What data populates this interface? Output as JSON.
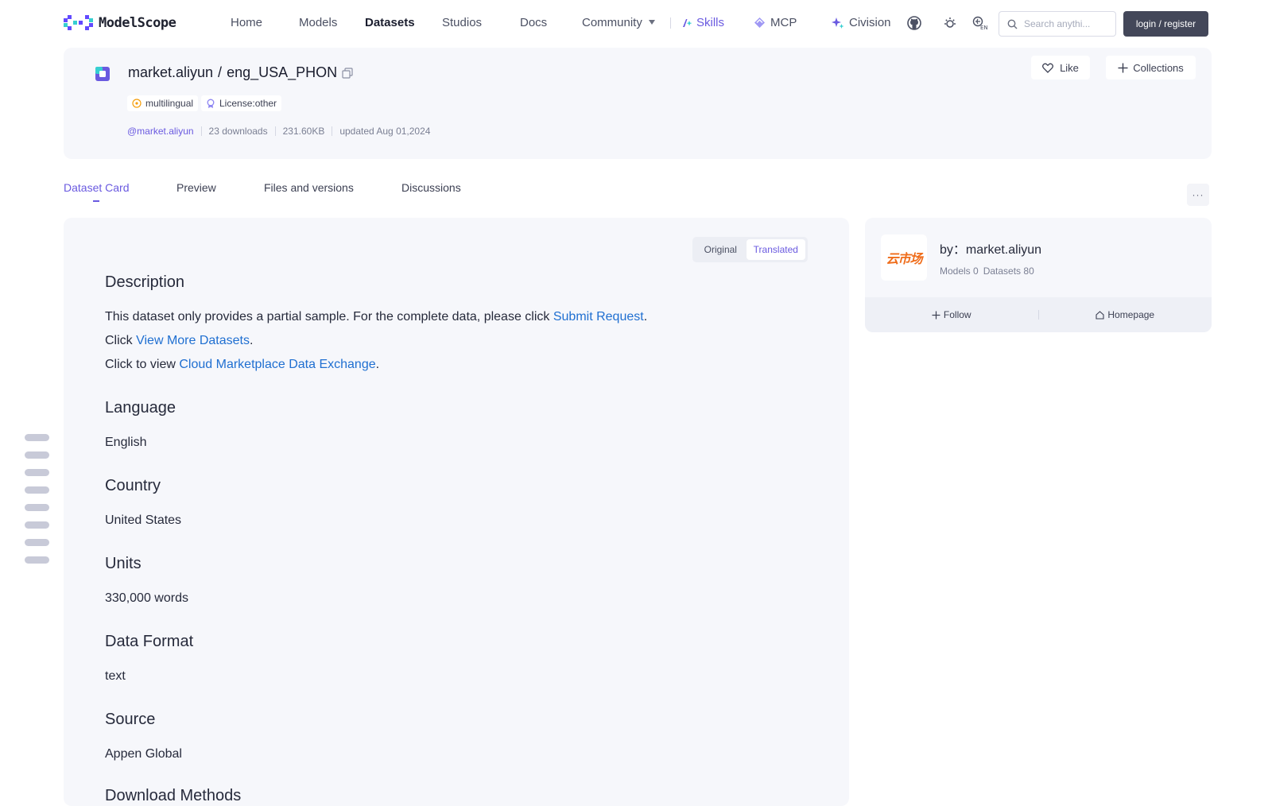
{
  "nav": {
    "logo_text": "ModelScope",
    "items": [
      "Home",
      "Models",
      "Datasets",
      "Studios",
      "Docs"
    ],
    "community": "Community",
    "skills": "Skills",
    "mcp": "MCP",
    "civision": "Civision",
    "search_placeholder": "Search anythi...",
    "login": "login / register"
  },
  "dataset": {
    "owner": "market.aliyun",
    "slash": "/",
    "name": "eng_USA_PHON",
    "tags": [
      "multilingual",
      "License:other"
    ],
    "owner_handle": "@market.aliyun",
    "downloads": "23 downloads",
    "size": "231.60KB",
    "updated": "updated Aug 01,2024",
    "like": "Like",
    "collections": "Collections"
  },
  "tabs": [
    "Dataset Card",
    "Preview",
    "Files and versions",
    "Discussions"
  ],
  "more": "···",
  "toggle": {
    "original": "Original",
    "translated": "Translated"
  },
  "card": {
    "description_h": "Description",
    "line1_pre": "This dataset only provides a partial sample. For the complete data, please click ",
    "line1_link": "Submit Request",
    "line1_post": ".",
    "line2_pre": "Click ",
    "line2_link": "View More Datasets",
    "line2_post": ".",
    "line3_pre": "Click to view ",
    "line3_link": "Cloud Marketplace Data Exchange",
    "line3_post": ".",
    "language_h": "Language",
    "language": "English",
    "country_h": "Country",
    "country": "United States",
    "units_h": "Units",
    "units": "330,000 words",
    "format_h": "Data Format",
    "format": "text",
    "source_h": "Source",
    "source": "Appen Global",
    "download_h": "Download Methods"
  },
  "author": {
    "logo_text": "云市场",
    "by": "by：market.aliyun",
    "models": "Models 0",
    "datasets": "Datasets 80",
    "follow": "Follow",
    "homepage": "Homepage"
  },
  "colors": {
    "accent": "#6a5ae0",
    "link": "#1f6fd1",
    "card_bg": "#f6f7fb",
    "login_bg": "#434759"
  }
}
